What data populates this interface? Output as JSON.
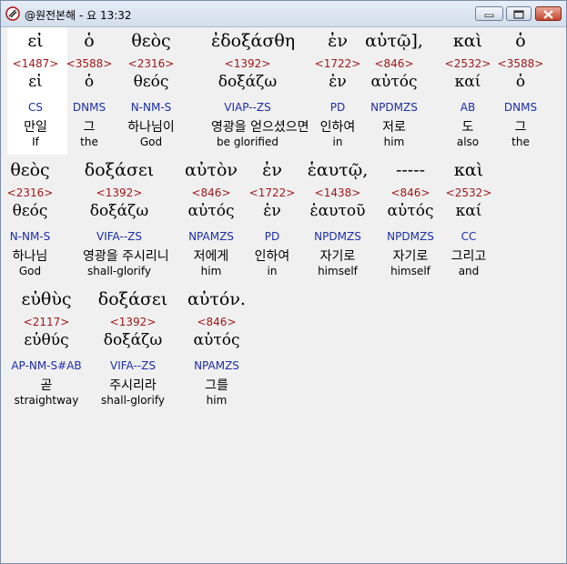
{
  "window": {
    "title": "@원전본해 - 요 13:32"
  },
  "rows": [
    [
      {
        "greek": "εἰ",
        "num": "<1487>",
        "lemma": "εἰ",
        "code": "CS",
        "ko": "만일",
        "en": "If"
      },
      {
        "greek": "ὁ",
        "num": "<3588>",
        "lemma": "ὁ",
        "code": "DNMS",
        "ko": "그",
        "en": "the"
      },
      {
        "greek": "θεὸς",
        "num": "<2316>",
        "lemma": "θεός",
        "code": "N-NM-S",
        "ko": "하나님이",
        "en": "God"
      },
      {
        "greek": "ἐδοξάσθη",
        "num": "<1392>",
        "lemma": "δοξάζω",
        "code": "VIAP--ZS",
        "ko": "영광을 얻으셨으면",
        "en": "be glorified"
      },
      {
        "greek": "ἐν",
        "num": "<1722>",
        "lemma": "ἐν",
        "code": "PD",
        "ko": "인하여",
        "en": "in"
      },
      {
        "greek": "αὐτῷ],",
        "num": "<846>",
        "lemma": "αὐτός",
        "code": "NPDMZS",
        "ko": "저로",
        "en": "him"
      },
      {
        "greek": "καὶ",
        "num": "<2532>",
        "lemma": "καί",
        "code": "AB",
        "ko": "도",
        "en": "also"
      },
      {
        "greek": "ὁ",
        "num": "<3588>",
        "lemma": "ὁ",
        "code": "DNMS",
        "ko": "그",
        "en": "the"
      }
    ],
    [
      {
        "greek": "θεὸς",
        "num": "<2316>",
        "lemma": "θεός",
        "code": "N-NM-S",
        "ko": "하나님",
        "en": "God"
      },
      {
        "greek": "δοξάσει",
        "num": "<1392>",
        "lemma": "δοξάζω",
        "code": "VIFA--ZS",
        "ko": "영광을 주시리니",
        "en": "shall-glorify"
      },
      {
        "greek": "αὐτὸν",
        "num": "<846>",
        "lemma": "αὐτός",
        "code": "NPAMZS",
        "ko": "저에게",
        "en": "him"
      },
      {
        "greek": "ἐν",
        "num": "<1722>",
        "lemma": "ἐν",
        "code": "PD",
        "ko": "인하여",
        "en": "in"
      },
      {
        "greek": "ἑαυτῷ,",
        "num": "<1438>",
        "lemma": "ἑαυτοῦ",
        "code": "NPDMZS",
        "ko": "자기로",
        "en": "himself"
      },
      {
        "greek": "-----",
        "num": "<846>",
        "lemma": "αὐτός",
        "code": "NPDMZS",
        "ko": "자기로",
        "en": "himself"
      },
      {
        "greek": "καὶ",
        "num": "<2532>",
        "lemma": "καί",
        "code": "CC",
        "ko": "그리고",
        "en": "and"
      }
    ],
    [
      {
        "greek": "εὐθὺς",
        "num": "<2117>",
        "lemma": "εὐθύς",
        "code": "AP-NM-S#AB",
        "ko": "곧",
        "en": "straightway"
      },
      {
        "greek": "δοξάσει",
        "num": "<1392>",
        "lemma": "δοξάζω",
        "code": "VIFA--ZS",
        "ko": "주시리라",
        "en": "shall-glorify"
      },
      {
        "greek": "αὐτόν.",
        "num": "<846>",
        "lemma": "αὐτός",
        "code": "NPAMZS",
        "ko": "그를",
        "en": "him"
      }
    ]
  ]
}
